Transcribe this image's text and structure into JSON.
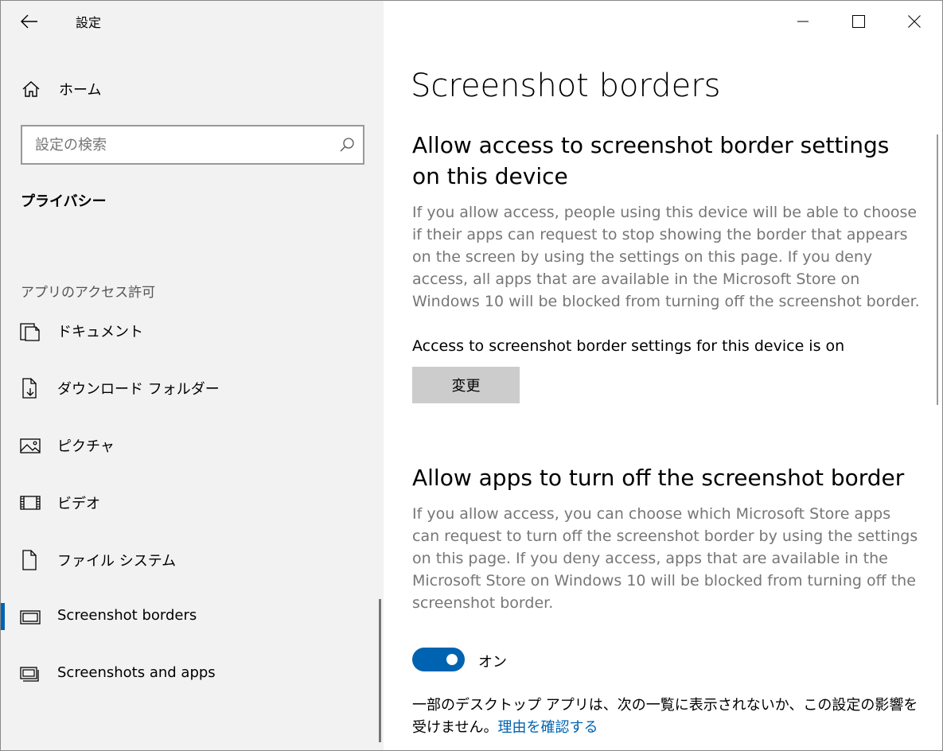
{
  "window": {
    "app_title": "設定"
  },
  "sidebar": {
    "home_label": "ホーム",
    "search_placeholder": "設定の検索",
    "category_title": "プライバシー",
    "section_label": "アプリのアクセス許可",
    "items": [
      {
        "label": "ドキュメント",
        "icon": "documents-icon"
      },
      {
        "label": "ダウンロード フォルダー",
        "icon": "downloads-folder-icon"
      },
      {
        "label": "ピクチャ",
        "icon": "pictures-icon"
      },
      {
        "label": "ビデオ",
        "icon": "videos-icon"
      },
      {
        "label": "ファイル システム",
        "icon": "file-system-icon"
      },
      {
        "label": "Screenshot borders",
        "icon": "screenshot-borders-icon",
        "selected": true
      },
      {
        "label": "Screenshots and apps",
        "icon": "screenshots-apps-icon"
      }
    ]
  },
  "main": {
    "page_title": "Screenshot borders",
    "section1": {
      "heading": "Allow access to screenshot border settings on this device",
      "description": "If you allow access, people using this device will be able to choose if their apps can request to stop showing the border that appears on the screen by using the settings on this page. If you deny access, all apps that are available in the Microsoft Store on Windows 10 will be blocked from turning off the screenshot border.",
      "status": "Access to screenshot border settings for this device is on",
      "change_button": "変更"
    },
    "section2": {
      "heading": "Allow apps to turn off the screenshot border",
      "description": "If you allow access, you can choose which Microsoft Store apps can request to turn off the screenshot border by using the settings on this page. If you deny access, apps that are available in the Microsoft Store on Windows 10 will be blocked from turning off the screenshot border.",
      "toggle_state": "on",
      "toggle_label": "オン",
      "note_text": "一部のデスクトップ アプリは、次の一覧に表示されないか、この設定の影響を受けません。",
      "note_link": "理由を確認する"
    }
  },
  "colors": {
    "accent": "#0063b1",
    "sidebar_bg": "#f2f2f2",
    "description_text": "#767676",
    "button_bg": "#cccccc"
  }
}
